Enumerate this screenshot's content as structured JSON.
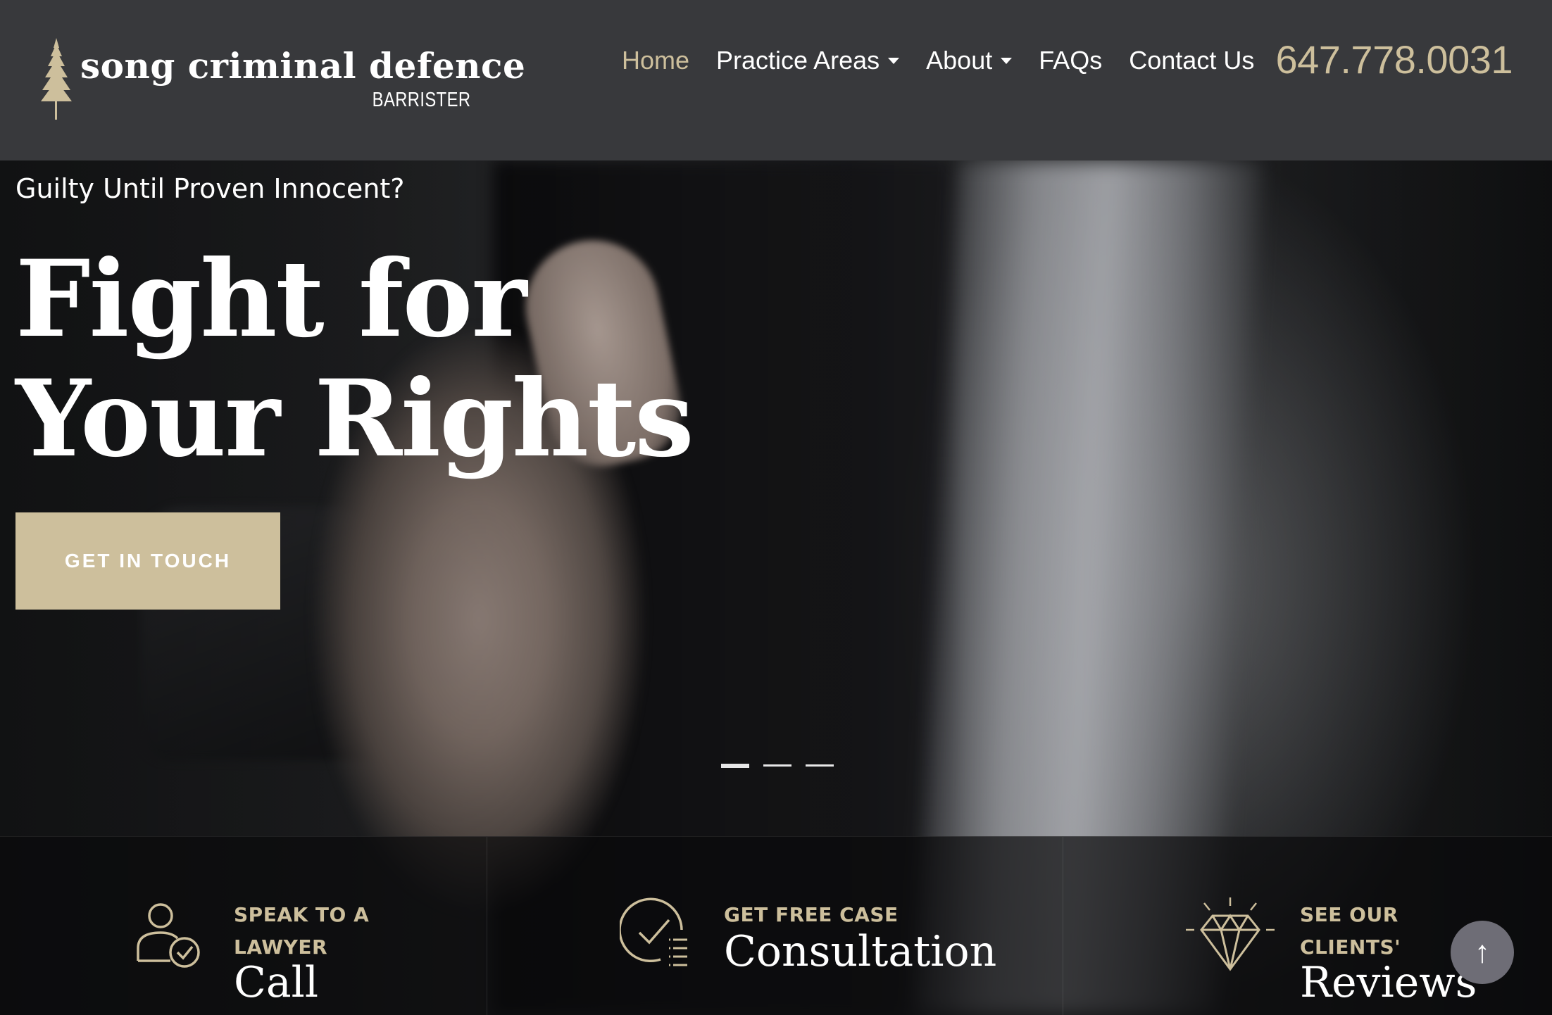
{
  "header": {
    "logo_name": "song criminal defence",
    "logo_sub": "BARRISTER",
    "nav": [
      {
        "label": "Home",
        "active": true
      },
      {
        "label": "Practice Areas",
        "dropdown": true
      },
      {
        "label": "About",
        "dropdown": true
      },
      {
        "label": "FAQs"
      },
      {
        "label": "Contact Us"
      }
    ],
    "phone": "647.778.0031"
  },
  "hero": {
    "eyebrow": "Guilty Until Proven Innocent?",
    "title_line1": "Fight for",
    "title_line2": "Your Rights",
    "cta_label": "GET IN TOUCH",
    "slides": 3,
    "active_slide": 1
  },
  "features": [
    {
      "kicker_line1": "SPEAK TO A",
      "kicker_line2": "LAWYER",
      "big": "Call",
      "icon": "user-check-icon"
    },
    {
      "kicker_line1": "GET FREE CASE",
      "kicker_line2": "",
      "big": "Consultation",
      "icon": "checklist-icon"
    },
    {
      "kicker_line1": "SEE OUR",
      "kicker_line2": "CLIENTS'",
      "big": "Reviews",
      "icon": "diamond-icon"
    }
  ],
  "scroll_top_label": "↑",
  "colors": {
    "header_bg": "#38393c",
    "accent_gold": "#cdbf9c",
    "text": "#ffffff",
    "scroll_btn": "#6e6d76"
  }
}
